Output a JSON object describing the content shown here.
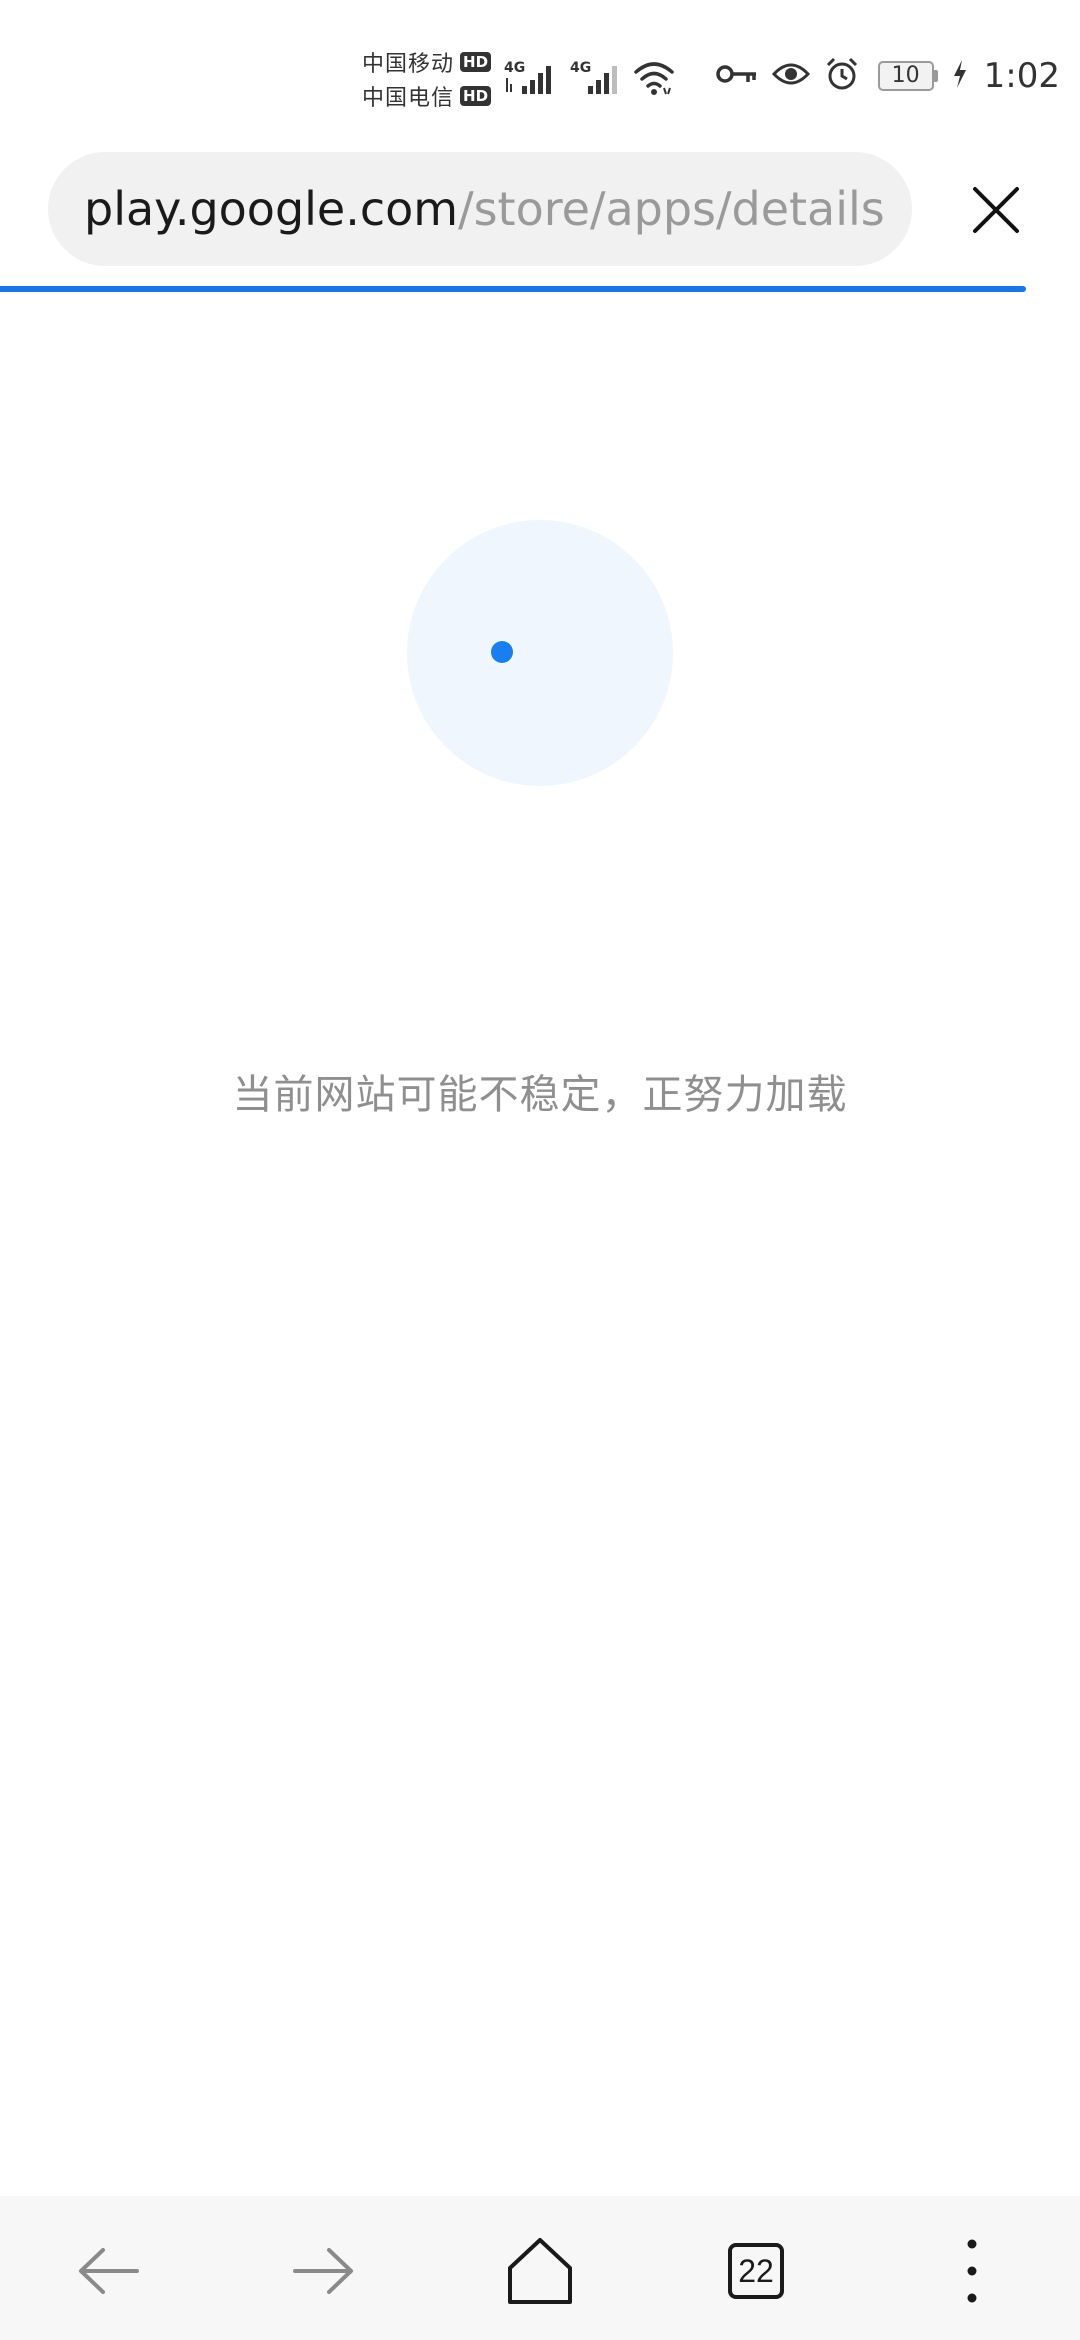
{
  "status_bar": {
    "carriers": [
      {
        "name": "中国移动",
        "badge": "HD"
      },
      {
        "name": "中国电信",
        "badge": "HD"
      }
    ],
    "network_labels": [
      "4G",
      "4G"
    ],
    "icons": [
      "signal-icon",
      "signal-icon",
      "wifi-icon",
      "vpn-key-icon",
      "eye-comfort-icon",
      "alarm-icon",
      "battery-icon",
      "charging-icon"
    ],
    "battery_level": "10",
    "time": "1:02"
  },
  "url_bar": {
    "host": "play.google.com",
    "path": "/store/apps/details?i",
    "close_icon": "close-icon"
  },
  "colors": {
    "accent": "#1976e3",
    "loader_bg": "#eff6fe",
    "muted_text": "#8f8f8f"
  },
  "page": {
    "loading_message": "当前网站可能不稳定，正努力加载"
  },
  "bottom_nav": {
    "icons": [
      "back-arrow-icon",
      "forward-arrow-icon",
      "home-icon",
      "tabs-icon",
      "more-vert-icon"
    ],
    "tab_count": "22"
  }
}
